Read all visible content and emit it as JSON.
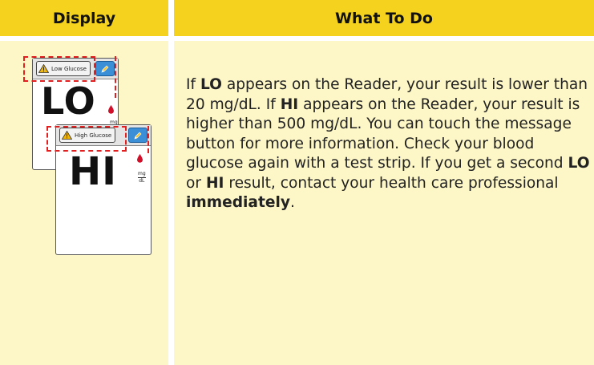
{
  "table": {
    "headers": {
      "display": "Display",
      "what_to_do": "What To Do"
    },
    "colors": {
      "header_bg": "#f5d21e",
      "body_bg": "#fdf6c6",
      "alert_dash": "#e02020",
      "drop": "#d0102a",
      "edit_button": "#3a8fd6"
    }
  },
  "reader_lo": {
    "message_label": "Low Glucose",
    "message_icon": "warning-triangle-icon",
    "edit_icon": "pencil-icon",
    "value": "LO",
    "unit_top": "mg",
    "unit_bottom": "dL",
    "drop_icon": "blood-drop-icon"
  },
  "reader_hi": {
    "message_label": "High Glucose",
    "message_icon": "warning-triangle-icon",
    "edit_icon": "pencil-icon",
    "value": "HI",
    "unit_top": "mg",
    "unit_bottom": "dL",
    "drop_icon": "blood-drop-icon"
  },
  "instructions": {
    "t1": "If ",
    "b1": "LO",
    "t2": " appears on the Reader, your result is lower than 20 mg/dL. If ",
    "b2": "HI",
    "t3": " appears on the Reader, your result is higher than 500 mg/dL. You can touch the message button for more information. Check your blood glucose again with a test strip. If you get a second ",
    "b3": "LO",
    "t4": " or ",
    "b4": "HI",
    "t5": " result, contact your health care professional ",
    "b5": "immediately",
    "t6": "."
  }
}
